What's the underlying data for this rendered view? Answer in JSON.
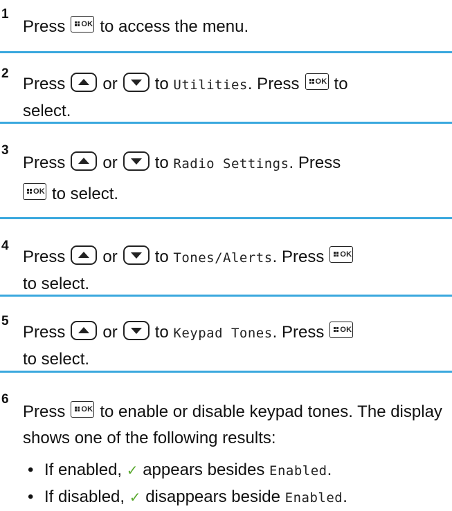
{
  "steps": [
    {
      "number": "1",
      "parts": {
        "a": "Press",
        "b": "to access the menu."
      }
    },
    {
      "number": "2",
      "parts": {
        "a": "Press",
        "or": "or",
        "to": "to",
        "menu": "Utilities",
        "press": ". Press",
        "to2": "to",
        "select": "select."
      }
    },
    {
      "number": "3",
      "parts": {
        "a": "Press",
        "or": "or",
        "to": "to",
        "menu": "Radio Settings",
        "press": ". Press",
        "select": "to select."
      }
    },
    {
      "number": "4",
      "parts": {
        "a": "Press",
        "or": "or",
        "to": "to",
        "menu": "Tones/Alerts",
        "press": ". Press",
        "select": "to select."
      }
    },
    {
      "number": "5",
      "parts": {
        "a": "Press",
        "or": "or",
        "to": "to",
        "menu": "Keypad Tones",
        "press": ". Press",
        "select": "to select."
      }
    },
    {
      "number": "6",
      "parts": {
        "a": "Press",
        "b": "to enable or disable keypad tones. The display shows one of the following results:"
      }
    }
  ],
  "results": [
    {
      "bullet": "•",
      "prefix": "If enabled,",
      "check": "✓",
      "middle": "appears besides",
      "value": "Enabled",
      "suffix": "."
    },
    {
      "bullet": "•",
      "prefix": "If disabled,",
      "check": "✓",
      "middle": "disappears beside",
      "value": "Enabled",
      "suffix": "."
    }
  ],
  "keys": {
    "ok_label": "OK"
  },
  "icons": [
    "menu-ok-key-icon",
    "up-arrow-key-icon",
    "down-arrow-key-icon",
    "checkmark-icon"
  ],
  "colors": {
    "divider": "#3aa8de",
    "check": "#57a82c"
  }
}
